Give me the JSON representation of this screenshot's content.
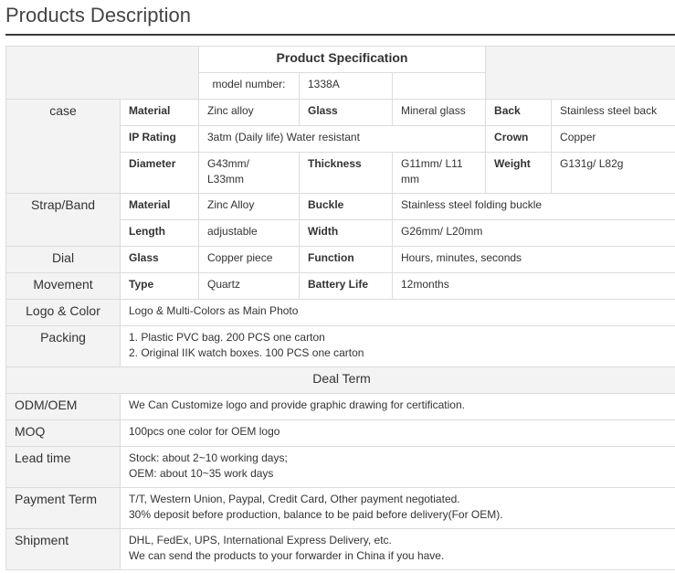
{
  "title": "Products Description",
  "spec": {
    "header": "Product Specification",
    "model_label": "model number:",
    "model_value": "1338A",
    "case": {
      "label": "case",
      "material_label": "Material",
      "material": "Zinc alloy",
      "glass_label": "Glass",
      "glass": "Mineral glass",
      "back_label": "Back",
      "back": "Stainless steel back",
      "ip_label": "IP Rating",
      "ip": "3atm (Daily life) Water resistant",
      "crown_label": "Crown",
      "crown": "Copper",
      "diameter_label": "Diameter",
      "diameter_1": "G43mm/",
      "diameter_2": "L33mm",
      "thickness_label": "Thickness",
      "thickness_1": "G11mm/ L11",
      "thickness_2": "mm",
      "weight_label": "Weight",
      "weight": "G131g/ L82g"
    },
    "strap": {
      "label": "Strap/Band",
      "material_label": "Material",
      "material": "Zinc Alloy",
      "buckle_label": "Buckle",
      "buckle": "Stainless steel folding buckle",
      "length_label": "Length",
      "length": "adjustable",
      "width_label": "Width",
      "width": "G26mm/ L20mm"
    },
    "dial": {
      "label": "Dial",
      "glass_label": "Glass",
      "glass": "Copper piece",
      "function_label": "Function",
      "function": "Hours, minutes, seconds"
    },
    "movement": {
      "label": "Movement",
      "type_label": "Type",
      "type": "Quartz",
      "battery_label": "Battery Life",
      "battery": "12months"
    },
    "logo": {
      "label": "Logo & Color",
      "value": "Logo & Multi-Colors as Main Photo"
    },
    "packing": {
      "label": "Packing",
      "line1": "1. Plastic PVC bag. 200 PCS one carton",
      "line2": "2. Original IIK watch boxes. 100 PCS one carton"
    }
  },
  "deal": {
    "header": "Deal Term",
    "odm": {
      "label": "ODM/OEM",
      "value": "We Can Customize logo and provide graphic drawing for certification."
    },
    "moq": {
      "label": "MOQ",
      "value": "100pcs one color for OEM logo"
    },
    "lead": {
      "label": "Lead time",
      "line1": "Stock: about 2~10 working days;",
      "line2": "OEM: about 10~35 work days"
    },
    "payment": {
      "label": "Payment Term",
      "line1": "T/T, Western Union, Paypal, Credit Card, Other payment negotiated.",
      "line2": "30% deposit before production, balance to be paid before delivery(For OEM)."
    },
    "shipment": {
      "label": "Shipment",
      "line1": "DHL, FedEx, UPS, International Express Delivery, etc.",
      "line2": "We can send the products to your forwarder in China if you have."
    }
  }
}
